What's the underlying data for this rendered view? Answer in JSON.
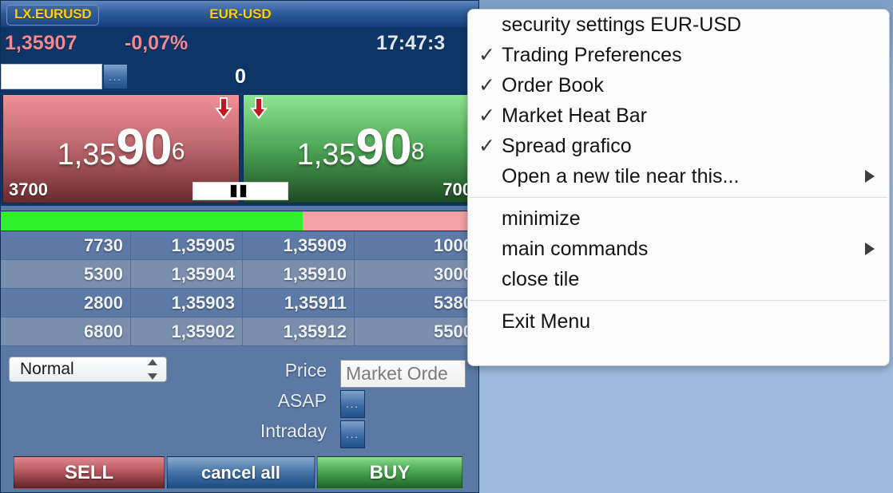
{
  "tile": {
    "symbol_chip": "LX.EURUSD",
    "title": "EUR-USD",
    "last_price": "1,35907",
    "pct_change": "-0,07%",
    "clock": "17:47:3",
    "qty_input_value": "",
    "qty_input_placeholder": "",
    "dots_label": "...",
    "net_position": "0",
    "bid": {
      "small": "1,35",
      "big": "90",
      "sup": "6",
      "qty": "3700",
      "arrow": "arrow-down-icon"
    },
    "ask": {
      "small": "1,35",
      "big": "90",
      "sup": "8",
      "qty": "700",
      "arrow": "arrow-down-icon"
    },
    "heatbar": {
      "green_pct": 63,
      "green_color": "#2ef02e",
      "red_color": "#f4a0a5"
    },
    "book": {
      "rows": [
        {
          "bid_qty": "7730",
          "bid_px": "1,35905",
          "ask_px": "1,35909",
          "ask_qty": "1000"
        },
        {
          "bid_qty": "5300",
          "bid_px": "1,35904",
          "ask_px": "1,35910",
          "ask_qty": "3000"
        },
        {
          "bid_qty": "2800",
          "bid_px": "1,35903",
          "ask_px": "1,35911",
          "ask_qty": "5380"
        },
        {
          "bid_qty": "6800",
          "bid_px": "1,35902",
          "ask_px": "1,35912",
          "ask_qty": "5500"
        }
      ]
    },
    "entry": {
      "order_type": "Normal",
      "price_label": "Price",
      "validity_label": "ASAP",
      "session_label": "Intraday",
      "price_value": "Market Orde",
      "dots_label": "...",
      "sell_label": "SELL",
      "cancel_label": "cancel all",
      "buy_label": "BUY"
    }
  },
  "context_menu": {
    "groups": [
      {
        "items": [
          {
            "label": "security settings EUR-USD",
            "checked": false,
            "submenu": false
          },
          {
            "label": "Trading Preferences",
            "checked": true,
            "submenu": false
          },
          {
            "label": "Order Book",
            "checked": true,
            "submenu": false
          },
          {
            "label": "Market Heat Bar",
            "checked": true,
            "submenu": false
          },
          {
            "label": "Spread grafico",
            "checked": true,
            "submenu": false
          },
          {
            "label": "Open a new tile near this...",
            "checked": false,
            "submenu": true
          }
        ]
      },
      {
        "items": [
          {
            "label": "minimize",
            "checked": false,
            "submenu": false
          },
          {
            "label": "main commands",
            "checked": false,
            "submenu": true
          },
          {
            "label": "close tile",
            "checked": false,
            "submenu": false
          }
        ]
      },
      {
        "items": [
          {
            "label": "Exit Menu",
            "checked": false,
            "submenu": false
          }
        ]
      }
    ],
    "check_glyph": "✓"
  },
  "colors": {
    "accent_yellow": "#ffd000",
    "bid_red": "#c06a70",
    "ask_green": "#4fa858",
    "header_blue": "#2d5a9a",
    "desktop_blue": "#9cbade"
  }
}
